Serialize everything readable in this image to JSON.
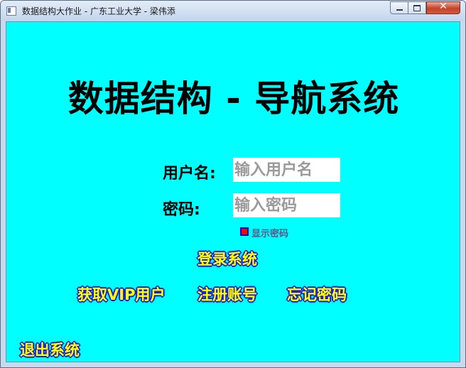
{
  "window": {
    "title": "数据结构大作业 - 广东工业大学 - 梁伟添",
    "icons": {
      "app": "app-window-icon",
      "minimize": "minimize-icon",
      "maximize": "maximize-icon",
      "close": "close-icon"
    },
    "close_glyph": "✕"
  },
  "main": {
    "title": "数据结构 - 导航系统",
    "background_color": "#00ffff",
    "username": {
      "label": "用户名:",
      "placeholder": "输入用户名",
      "value": ""
    },
    "password": {
      "label": "密码:",
      "placeholder": "输入密码",
      "value": ""
    },
    "show_password": {
      "label": "显示密码",
      "checked": false
    },
    "buttons": {
      "login": "登录系统",
      "get_vip": "获取VIP用户",
      "register": "注册账号",
      "forgot_password": "忘记密码",
      "exit": "退出系统"
    },
    "button_colors": {
      "text": "#ffff00",
      "outline": "#1b1bd6"
    }
  }
}
